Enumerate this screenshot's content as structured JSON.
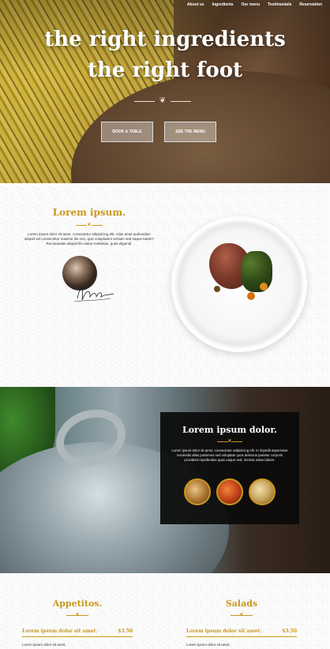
{
  "nav": {
    "items": [
      "About us",
      "Ingredients",
      "Our menu",
      "Testimonials",
      "Reservation"
    ]
  },
  "hero": {
    "line1": "the right ingredients",
    "line2": "the right foot",
    "book_label": "BOOK A TABLE",
    "menu_label": "SEE THE MENU"
  },
  "about": {
    "title": "Lorem ipsum.",
    "text": "Lorem ipsum dolor sit amet, consectetur adipisicing elit. Alias amet quibusdam aliquid vel consectetur maxime illo non, quis voluptatem veniam sed eaque totam? Recusandae aliquid illo natus molestias, quas eligendi."
  },
  "feature": {
    "title": "Lorem ipsum dolor.",
    "text": "Lorem ipsum dolor sit amet, consectetur adipisicing elit. In impedit aspernatur reiciendis alias possimus sed voluptate quos delectus pariatur corporis provident repellendus quas eaque sed, minima natus labore."
  },
  "menu": {
    "columns": [
      {
        "title": "Appetitos.",
        "item_name": "Lorem ipsum dolor sit amet.",
        "item_price": "$3.50",
        "item_desc": "Lorem ipsum dolor sit amet."
      },
      {
        "title": "Salads",
        "item_name": "Lorem ipsum dolor sit amet.",
        "item_price": "$3.50",
        "item_desc": "Lorem ipsum dolor sit amet."
      }
    ]
  },
  "colors": {
    "accent": "#c9981e",
    "dark_card": "#0a0a0a"
  }
}
